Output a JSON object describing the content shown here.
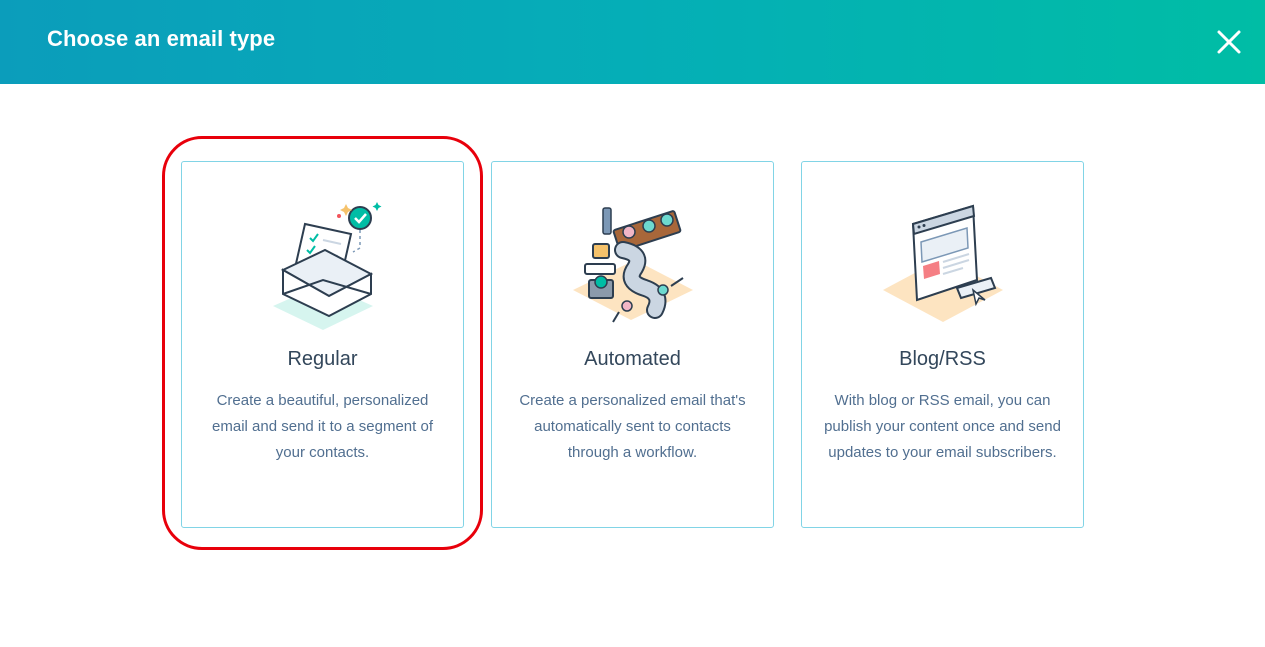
{
  "dialog": {
    "title": "Choose an email type",
    "close_icon": "close-icon",
    "header_gradient": [
      "#0b9dbb",
      "#00bda5"
    ]
  },
  "email_types": [
    {
      "title": "Regular",
      "description": "Create a beautiful, personalized email and send it to a segment of your contacts.",
      "icon": "envelope-checklist-illustration",
      "highlighted": true
    },
    {
      "title": "Automated",
      "description": "Create a personalized email that's automatically sent to contacts through a workflow.",
      "icon": "workflow-machine-illustration",
      "highlighted": false
    },
    {
      "title": "Blog/RSS",
      "description": "With blog or RSS email, you can publish your content once and send updates to your email subscribers.",
      "icon": "browser-window-illustration",
      "highlighted": false
    }
  ],
  "colors": {
    "card_border": "#81d4e6",
    "title_text": "#33475b",
    "body_text": "#516f90",
    "highlight_ring": "#e8000b"
  }
}
